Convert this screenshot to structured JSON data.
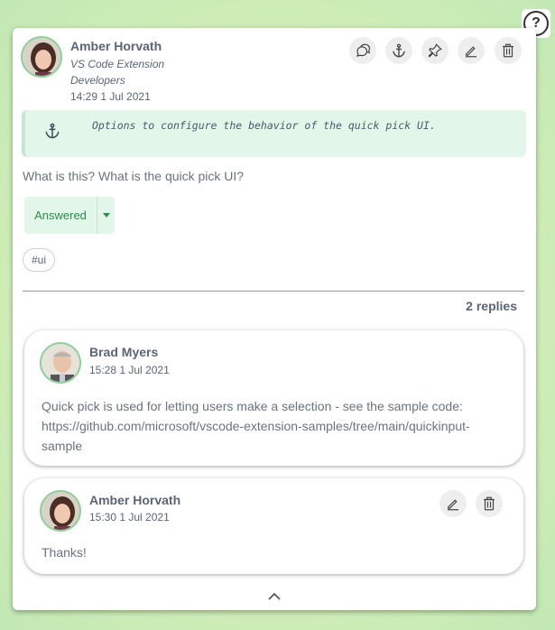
{
  "help": {
    "label": "?"
  },
  "post": {
    "author": "Amber Horvath",
    "team_line1": "VS Code Extension",
    "team_line2": "Developers",
    "timestamp": "14:29 1 Jul 2021",
    "actions": [
      "reply-icon",
      "anchor-icon",
      "pin-icon",
      "edit-icon",
      "trash-icon"
    ],
    "anchor_text": "Options to configure the behavior of the quick pick UI.",
    "question": "What is this? What is the quick pick UI?",
    "status": "Answered",
    "tag": "#ui",
    "reply_count": "2 replies"
  },
  "replies": [
    {
      "author": "Brad Myers",
      "timestamp": "15:28 1 Jul 2021",
      "text_line1": "Quick pick is used for letting users make a selection - see the sample code:",
      "text_line2": "https://github.com/microsoft/vscode-extension-samples/tree/main/quickinput-",
      "text_line3": "sample"
    },
    {
      "author": "Amber Horvath",
      "timestamp": "15:30 1 Jul 2021",
      "text_line1": "Thanks!",
      "actions": [
        "edit-icon",
        "trash-icon"
      ]
    }
  ],
  "colors": {
    "accent_green": "#2e8b4a",
    "anchor_bg": "#e2f6ea",
    "text": "#5a6478"
  }
}
